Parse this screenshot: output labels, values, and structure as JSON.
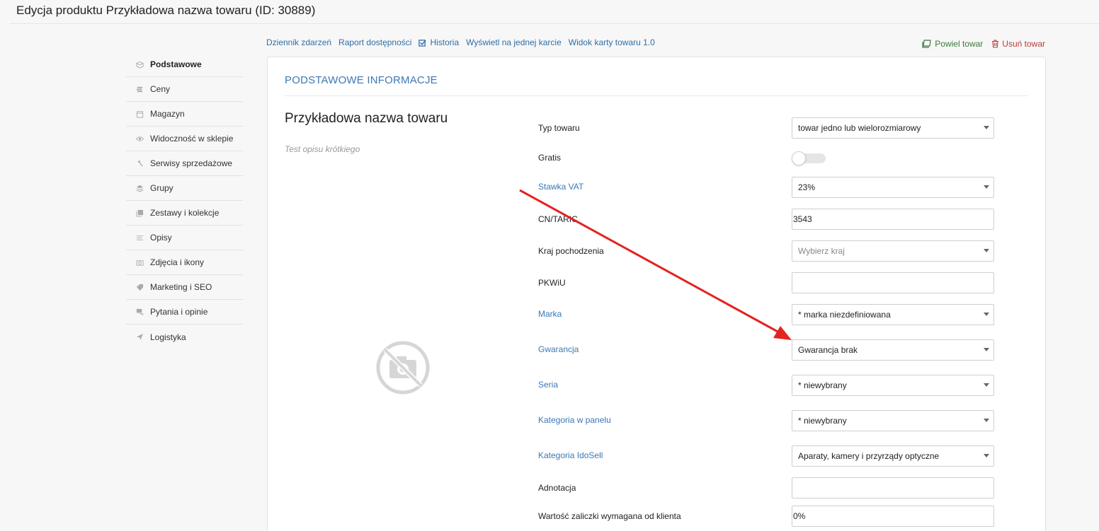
{
  "page": {
    "title": "Edycja produktu Przykładowa nazwa towaru (ID: 30889)"
  },
  "toolbar": {
    "links": [
      {
        "label": "Dziennik zdarzeń"
      },
      {
        "label": "Raport dostępności"
      },
      {
        "label": "Historia",
        "icon": "checkbox-icon"
      },
      {
        "label": "Wyświetl na jednej karcie"
      },
      {
        "label": "Widok karty towaru 1.0"
      }
    ],
    "duplicate_label": "Powiel towar",
    "delete_label": "Usuń towar"
  },
  "sidebar": {
    "items": [
      {
        "label": "Podstawowe",
        "icon": "box-icon",
        "active": true
      },
      {
        "label": "Ceny",
        "icon": "coins-icon"
      },
      {
        "label": "Magazyn",
        "icon": "calendar-icon"
      },
      {
        "label": "Widoczność w sklepie",
        "icon": "eye-icon"
      },
      {
        "label": "Serwisy sprzedażowe",
        "icon": "hammer-icon"
      },
      {
        "label": "Grupy",
        "icon": "layers-icon"
      },
      {
        "label": "Zestawy i kolekcje",
        "icon": "stack-icon"
      },
      {
        "label": "Opisy",
        "icon": "lines-icon"
      },
      {
        "label": "Zdjęcia i ikony",
        "icon": "camera-icon"
      },
      {
        "label": "Marketing i SEO",
        "icon": "tag-icon"
      },
      {
        "label": "Pytania i opinie",
        "icon": "chat-icon"
      },
      {
        "label": "Logistyka",
        "icon": "send-icon"
      }
    ]
  },
  "card": {
    "section_title": "PODSTAWOWE INFORMACJE",
    "product_name": "Przykładowa nazwa towaru",
    "short_description": "Test opisu krótkiego"
  },
  "form": {
    "typ_towaru": {
      "label": "Typ towaru",
      "value": "towar jedno lub wielorozmiarowy"
    },
    "gratis": {
      "label": "Gratis",
      "on": false
    },
    "stawka_vat": {
      "label": "Stawka VAT",
      "value": "23%"
    },
    "cn_taric": {
      "label": "CN/TARIC",
      "value": "3543"
    },
    "kraj": {
      "label": "Kraj pochodzenia",
      "placeholder": "Wybierz kraj"
    },
    "pkwiu": {
      "label": "PKWiU",
      "value": ""
    },
    "marka": {
      "label": "Marka",
      "value": "* marka niezdefiniowana"
    },
    "gwarancja": {
      "label": "Gwarancja",
      "value": "Gwarancja brak"
    },
    "seria": {
      "label": "Seria",
      "value": "* niewybrany"
    },
    "kategoria_panel": {
      "label": "Kategoria w panelu",
      "value": "* niewybrany"
    },
    "kategoria_idosell": {
      "label": "Kategoria IdoSell",
      "value": "Aparaty, kamery i przyrządy optyczne"
    },
    "adnotacja": {
      "label": "Adnotacja",
      "value": ""
    },
    "zaliczka": {
      "label": "Wartość zaliczki wymagana od klienta",
      "value": "0%"
    }
  },
  "colors": {
    "link": "#3c78b4",
    "arrow": "#e52222",
    "duplicate": "#3b7a3b",
    "delete": "#b83b3b"
  }
}
